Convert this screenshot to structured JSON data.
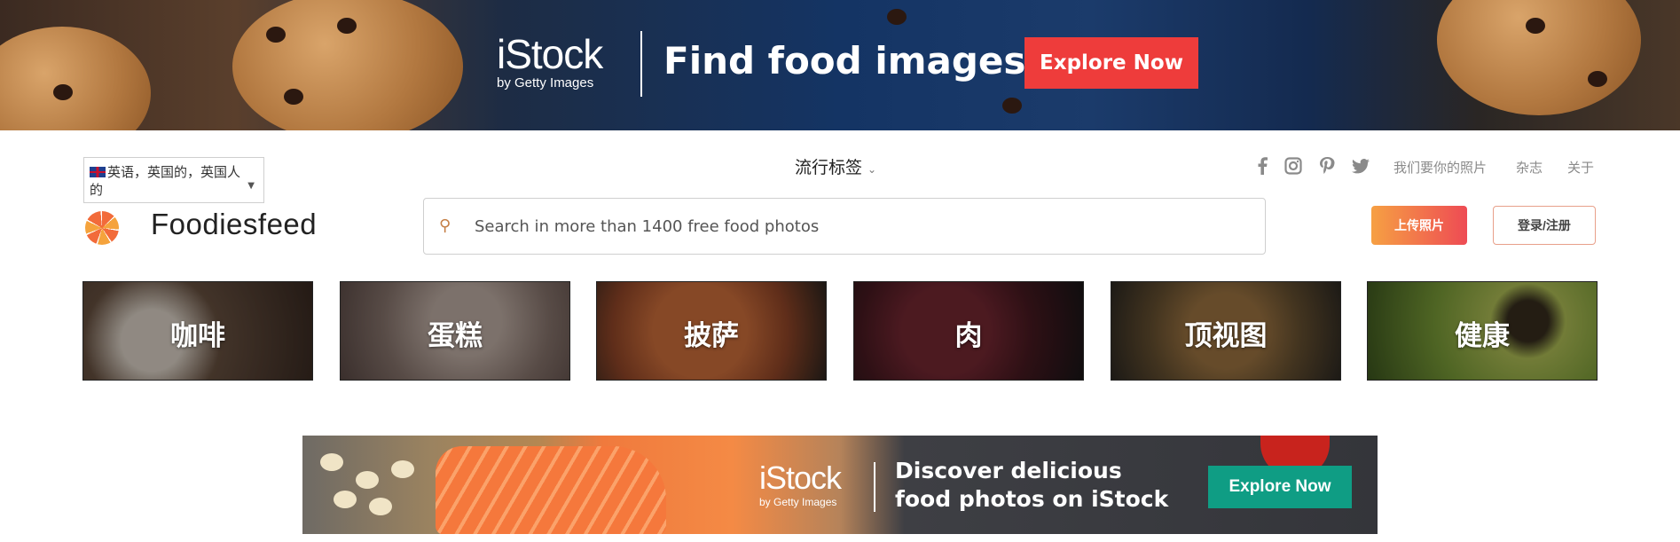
{
  "top_banner": {
    "brand": "iStock",
    "brand_sub": "by Getty Images",
    "headline": "Find food images",
    "cta": "Explore Now"
  },
  "header": {
    "language": "英语，英国的，英国人的",
    "popular_tags": "流行标签",
    "social_icons": [
      "facebook-icon",
      "instagram-icon",
      "pinterest-icon",
      "twitter-icon"
    ],
    "links": [
      "我们要你的照片",
      "杂志",
      "关于"
    ],
    "logo": "Foodiesfeed",
    "search_placeholder": "Search in more than 1400 free food photos",
    "upload": "上传照片",
    "login": "登录/注册"
  },
  "categories": [
    {
      "label": "咖啡",
      "color": "#8a7560"
    },
    {
      "label": "蛋糕",
      "color": "#9e8c86"
    },
    {
      "label": "披萨",
      "color": "#b0603e"
    },
    {
      "label": "肉",
      "color": "#5a2a2e"
    },
    {
      "label": "顶视图",
      "color": "#6e5a3c"
    },
    {
      "label": "健康",
      "color": "#6f8a3a"
    }
  ],
  "bottom_banner": {
    "brand": "iStock",
    "brand_sub": "by Getty Images",
    "headline": "Discover delicious food photos on iStock",
    "cta": "Explore Now"
  }
}
